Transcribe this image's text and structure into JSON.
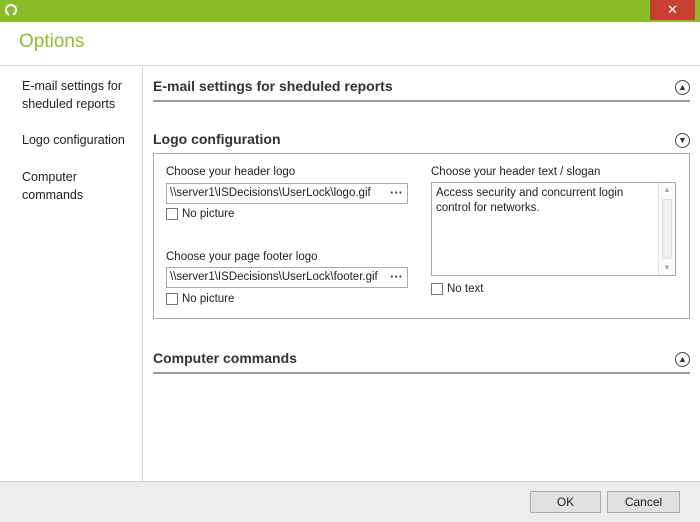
{
  "window": {
    "title": "Options",
    "close_glyph": "✕",
    "title_bar_color": "#8bbd2a",
    "close_button_color": "#c8402f"
  },
  "sidebar": {
    "items": [
      {
        "label_line1": "E-mail settings for",
        "label_line2": "sheduled reports"
      },
      {
        "label_line1": "Logo configuration"
      },
      {
        "label_line1": "Computer",
        "label_line2": "commands"
      }
    ]
  },
  "sections": {
    "email": {
      "title": "E-mail settings for sheduled reports",
      "chevron": "up",
      "chevron_glyph": "▲"
    },
    "logo": {
      "title": "Logo configuration",
      "chevron": "down",
      "chevron_glyph": "▼"
    },
    "commands": {
      "title": "Computer commands",
      "chevron": "up",
      "chevron_glyph": "▲"
    }
  },
  "logo_config": {
    "header_logo_label": "Choose your header logo",
    "header_logo_path": "\\\\server1\\ISDecisions\\UserLock\\logo.gif",
    "header_no_picture": "No picture",
    "footer_logo_label": "Choose your page footer logo",
    "footer_logo_path": "\\\\server1\\ISDecisions\\UserLock\\footer.gif",
    "footer_no_picture": "No picture",
    "browse_glyph": "···",
    "slogan_label": "Choose your header text / slogan",
    "slogan_text": "Access security and concurrent login control for networks.",
    "no_text": "No text",
    "scroll_up_glyph": "▲",
    "scroll_down_glyph": "▼"
  },
  "footer": {
    "ok": "OK",
    "cancel": "Cancel"
  }
}
